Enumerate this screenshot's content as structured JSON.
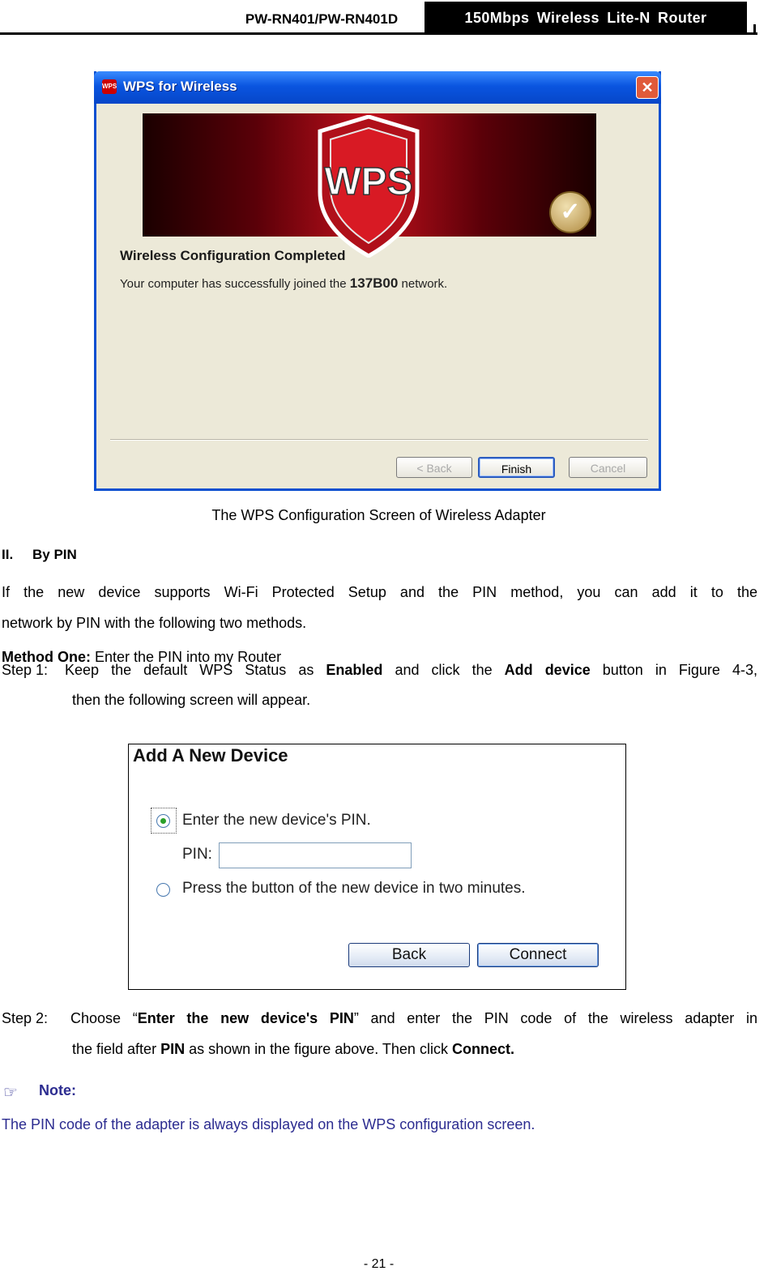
{
  "header": {
    "model": "PW-RN401/PW-RN401D",
    "product": "150Mbps  Wireless  Lite-N  Router"
  },
  "wps_window": {
    "title": "WPS for Wireless",
    "close_glyph": "✕",
    "logo_text": "WPS",
    "heading": "Wireless Configuration Completed",
    "message_pre": "Your computer has successfully joined the ",
    "network_name": "137B00",
    "message_post": " network.",
    "buttons": {
      "back": "< Back",
      "finish": "Finish",
      "cancel": "Cancel"
    },
    "icons": {
      "title": "wps-app-icon",
      "success": "checkmark-icon"
    }
  },
  "caption": "The WPS Configuration Screen of Wireless Adapter",
  "section": {
    "number": "II.",
    "title": "By PIN"
  },
  "para1_line1": "If the new device supports Wi-Fi Protected Setup and the PIN method, you can add it to the",
  "para1_line2": "network by PIN with the following two methods.",
  "method": {
    "label": "Method One:",
    "text": " Enter the PIN into my Router"
  },
  "step1": {
    "label": "Step 1:",
    "pre": "Keep the default WPS Status as ",
    "b1": "Enabled",
    "mid": " and click the ",
    "b2": "Add device",
    "post": " button in Figure 4-3,",
    "line2": "then the following screen will appear."
  },
  "add_device": {
    "title": "Add A New Device",
    "option1": "Enter the new device's PIN.",
    "pin_label": "PIN:",
    "pin_value": "",
    "option2": "Press the button of the new device in two minutes.",
    "back": "Back",
    "connect": "Connect",
    "selected_option": 1
  },
  "step2": {
    "label": "Step 2:",
    "pre": "Choose “",
    "b1": "Enter the new device's PIN",
    "post": "” and enter the PIN code of the wireless adapter in",
    "line2_pre": "the field after ",
    "b2": "PIN",
    "line2_mid": " as shown in the figure above. Then click ",
    "b3": "Connect."
  },
  "note": {
    "icon": "pointing-hand-icon",
    "label": "Note:",
    "text": "The PIN code of the adapter is always displayed on the WPS configuration screen."
  },
  "page_number": "- 21 -"
}
